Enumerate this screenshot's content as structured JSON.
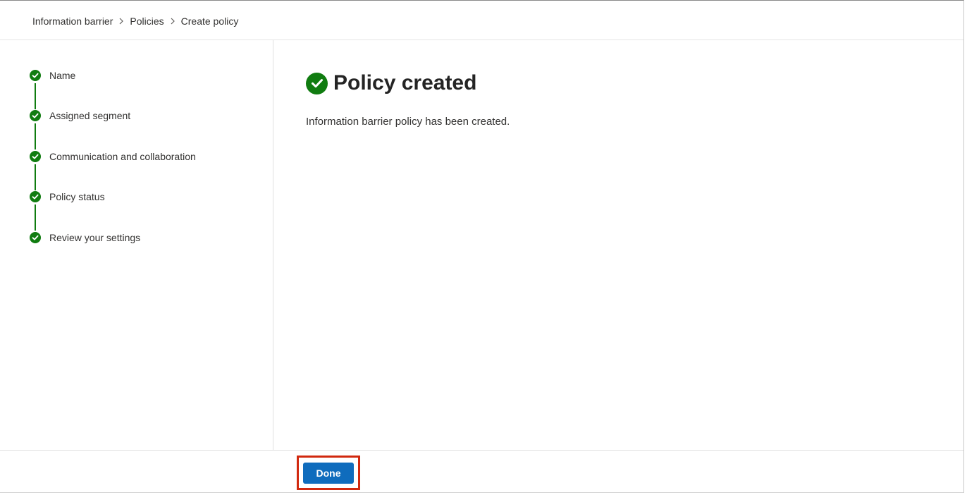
{
  "breadcrumb": {
    "items": [
      "Information barrier",
      "Policies",
      "Create policy"
    ]
  },
  "steps": [
    {
      "label": "Name",
      "status": "completed"
    },
    {
      "label": "Assigned segment",
      "status": "completed"
    },
    {
      "label": "Communication and collaboration",
      "status": "completed"
    },
    {
      "label": "Policy status",
      "status": "completed"
    },
    {
      "label": "Review your settings",
      "status": "completed"
    }
  ],
  "result": {
    "title": "Policy created",
    "message": "Information barrier policy has been created.",
    "icon": "checkmark-circle-icon"
  },
  "footer": {
    "done_label": "Done"
  },
  "colors": {
    "success": "#107c10",
    "primary": "#0f6cbd",
    "highlight": "#d1290f"
  }
}
